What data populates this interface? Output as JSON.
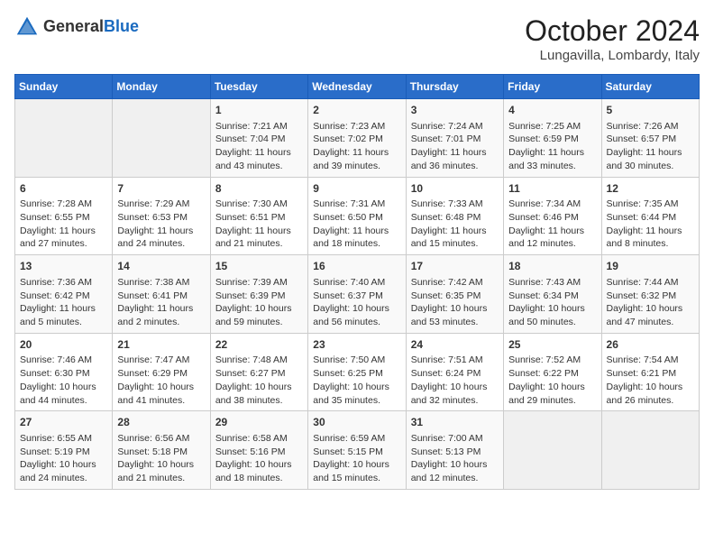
{
  "header": {
    "logo_general": "General",
    "logo_blue": "Blue",
    "month_title": "October 2024",
    "location": "Lungavilla, Lombardy, Italy"
  },
  "days_of_week": [
    "Sunday",
    "Monday",
    "Tuesday",
    "Wednesday",
    "Thursday",
    "Friday",
    "Saturday"
  ],
  "weeks": [
    [
      {
        "day": "",
        "info": ""
      },
      {
        "day": "",
        "info": ""
      },
      {
        "day": "1",
        "info": "Sunrise: 7:21 AM\nSunset: 7:04 PM\nDaylight: 11 hours and 43 minutes."
      },
      {
        "day": "2",
        "info": "Sunrise: 7:23 AM\nSunset: 7:02 PM\nDaylight: 11 hours and 39 minutes."
      },
      {
        "day": "3",
        "info": "Sunrise: 7:24 AM\nSunset: 7:01 PM\nDaylight: 11 hours and 36 minutes."
      },
      {
        "day": "4",
        "info": "Sunrise: 7:25 AM\nSunset: 6:59 PM\nDaylight: 11 hours and 33 minutes."
      },
      {
        "day": "5",
        "info": "Sunrise: 7:26 AM\nSunset: 6:57 PM\nDaylight: 11 hours and 30 minutes."
      }
    ],
    [
      {
        "day": "6",
        "info": "Sunrise: 7:28 AM\nSunset: 6:55 PM\nDaylight: 11 hours and 27 minutes."
      },
      {
        "day": "7",
        "info": "Sunrise: 7:29 AM\nSunset: 6:53 PM\nDaylight: 11 hours and 24 minutes."
      },
      {
        "day": "8",
        "info": "Sunrise: 7:30 AM\nSunset: 6:51 PM\nDaylight: 11 hours and 21 minutes."
      },
      {
        "day": "9",
        "info": "Sunrise: 7:31 AM\nSunset: 6:50 PM\nDaylight: 11 hours and 18 minutes."
      },
      {
        "day": "10",
        "info": "Sunrise: 7:33 AM\nSunset: 6:48 PM\nDaylight: 11 hours and 15 minutes."
      },
      {
        "day": "11",
        "info": "Sunrise: 7:34 AM\nSunset: 6:46 PM\nDaylight: 11 hours and 12 minutes."
      },
      {
        "day": "12",
        "info": "Sunrise: 7:35 AM\nSunset: 6:44 PM\nDaylight: 11 hours and 8 minutes."
      }
    ],
    [
      {
        "day": "13",
        "info": "Sunrise: 7:36 AM\nSunset: 6:42 PM\nDaylight: 11 hours and 5 minutes."
      },
      {
        "day": "14",
        "info": "Sunrise: 7:38 AM\nSunset: 6:41 PM\nDaylight: 11 hours and 2 minutes."
      },
      {
        "day": "15",
        "info": "Sunrise: 7:39 AM\nSunset: 6:39 PM\nDaylight: 10 hours and 59 minutes."
      },
      {
        "day": "16",
        "info": "Sunrise: 7:40 AM\nSunset: 6:37 PM\nDaylight: 10 hours and 56 minutes."
      },
      {
        "day": "17",
        "info": "Sunrise: 7:42 AM\nSunset: 6:35 PM\nDaylight: 10 hours and 53 minutes."
      },
      {
        "day": "18",
        "info": "Sunrise: 7:43 AM\nSunset: 6:34 PM\nDaylight: 10 hours and 50 minutes."
      },
      {
        "day": "19",
        "info": "Sunrise: 7:44 AM\nSunset: 6:32 PM\nDaylight: 10 hours and 47 minutes."
      }
    ],
    [
      {
        "day": "20",
        "info": "Sunrise: 7:46 AM\nSunset: 6:30 PM\nDaylight: 10 hours and 44 minutes."
      },
      {
        "day": "21",
        "info": "Sunrise: 7:47 AM\nSunset: 6:29 PM\nDaylight: 10 hours and 41 minutes."
      },
      {
        "day": "22",
        "info": "Sunrise: 7:48 AM\nSunset: 6:27 PM\nDaylight: 10 hours and 38 minutes."
      },
      {
        "day": "23",
        "info": "Sunrise: 7:50 AM\nSunset: 6:25 PM\nDaylight: 10 hours and 35 minutes."
      },
      {
        "day": "24",
        "info": "Sunrise: 7:51 AM\nSunset: 6:24 PM\nDaylight: 10 hours and 32 minutes."
      },
      {
        "day": "25",
        "info": "Sunrise: 7:52 AM\nSunset: 6:22 PM\nDaylight: 10 hours and 29 minutes."
      },
      {
        "day": "26",
        "info": "Sunrise: 7:54 AM\nSunset: 6:21 PM\nDaylight: 10 hours and 26 minutes."
      }
    ],
    [
      {
        "day": "27",
        "info": "Sunrise: 6:55 AM\nSunset: 5:19 PM\nDaylight: 10 hours and 24 minutes."
      },
      {
        "day": "28",
        "info": "Sunrise: 6:56 AM\nSunset: 5:18 PM\nDaylight: 10 hours and 21 minutes."
      },
      {
        "day": "29",
        "info": "Sunrise: 6:58 AM\nSunset: 5:16 PM\nDaylight: 10 hours and 18 minutes."
      },
      {
        "day": "30",
        "info": "Sunrise: 6:59 AM\nSunset: 5:15 PM\nDaylight: 10 hours and 15 minutes."
      },
      {
        "day": "31",
        "info": "Sunrise: 7:00 AM\nSunset: 5:13 PM\nDaylight: 10 hours and 12 minutes."
      },
      {
        "day": "",
        "info": ""
      },
      {
        "day": "",
        "info": ""
      }
    ]
  ]
}
